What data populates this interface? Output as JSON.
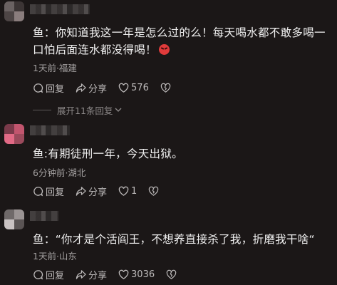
{
  "comments": [
    {
      "text": "鱼：你知道我这一年是怎么过的么！每天喝水都不敢多喝一口怕后面连水都没得喝！",
      "emoji": "angry-face-emoji",
      "meta": "1天前·福建",
      "reply_label": "回复",
      "share_label": "分享",
      "like_count": "576"
    },
    {
      "text": "鱼:有期徒刑一年，今天出狱。",
      "meta": "6分钟前·湖北",
      "reply_label": "回复",
      "share_label": "分享",
      "like_count": "1"
    },
    {
      "text": "鱼：“你才是个活阎王，不想养直接杀了我，折磨我干啥“",
      "meta": "1天前·山东",
      "reply_label": "回复",
      "share_label": "分享",
      "like_count": "3036"
    }
  ],
  "expand_replies_label": "展开11条回复",
  "colors": {
    "background": "#1b1717",
    "text": "#f0f0f0",
    "meta": "#a3a0a0",
    "emoji": "#e03b3b"
  }
}
